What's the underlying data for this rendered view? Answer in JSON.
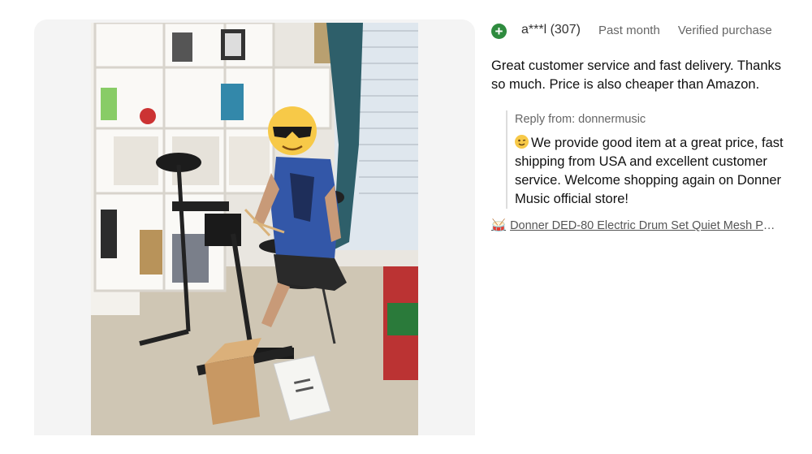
{
  "review": {
    "reviewer": "a***l (307)",
    "time": "Past month",
    "badge": "Verified purchase",
    "avatar_icon": "plus-icon",
    "avatar_color": "#2e8b3e",
    "text": "Great customer service and fast delivery. Thanks so much. Price is also cheaper than Amazon."
  },
  "reply": {
    "label": "Reply from: donnermusic",
    "emoji_icon": "winking-face-icon",
    "text": "We provide good item at a great price, fast shipping from USA and excellent customer service. Welcome shopping again on Donner Music official store!"
  },
  "product": {
    "icon": "drum-icon",
    "title": "Donner DED-80 Electric Drum Set Quiet Mesh Pad..."
  }
}
